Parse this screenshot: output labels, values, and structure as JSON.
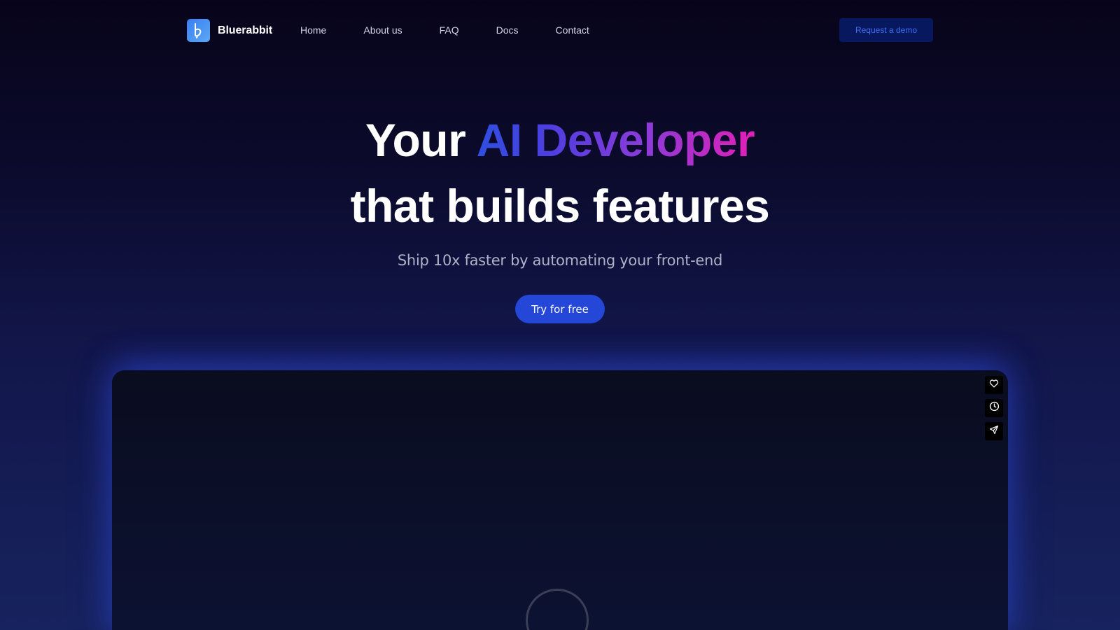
{
  "nav": {
    "brand": "Bluerabbit",
    "links": [
      "Home",
      "About us",
      "FAQ",
      "Docs",
      "Contact"
    ],
    "cta": "Request a demo"
  },
  "hero": {
    "line1_plain": "Your",
    "line1_highlight": "AI Developer",
    "line2": "that builds features",
    "subtitle": "Ship 10x faster by automating your front-end",
    "cta": "Try for free"
  },
  "preview": {
    "tools": [
      "heart-icon",
      "clock-icon",
      "send-icon"
    ]
  },
  "colors": {
    "accent": "#2447d8",
    "demo_button_bg": "#07185e",
    "gradient_start": "#2f4fe0",
    "gradient_end": "#e21fb7"
  }
}
